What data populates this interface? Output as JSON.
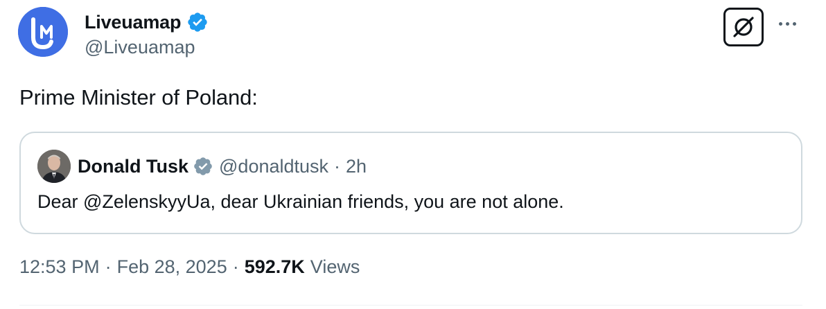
{
  "author": {
    "display_name": "Liveuamap",
    "handle": "@Liveuamap",
    "avatar_letters": "LM",
    "avatar_color": "#3f6ee4",
    "verified": true
  },
  "tweet": {
    "text": "Prime Minister of Poland:"
  },
  "quoted_tweet": {
    "display_name": "Donald Tusk",
    "handle": "@donaldtusk",
    "separator": "·",
    "time": "2h",
    "verified": true,
    "text": "Dear @ZelenskyyUa, dear Ukrainian friends, you are not alone."
  },
  "meta": {
    "time": "12:53 PM",
    "separator": "·",
    "date": "Feb 28, 2025",
    "views_count": "592.7K",
    "views_label": "Views"
  },
  "colors": {
    "verified_blue": "#1d9bf0",
    "verified_grey": "#829aab",
    "secondary_text": "#536471",
    "border": "#cfd9de"
  },
  "icons": {
    "grok": "grok-icon",
    "more": "more-icon"
  }
}
